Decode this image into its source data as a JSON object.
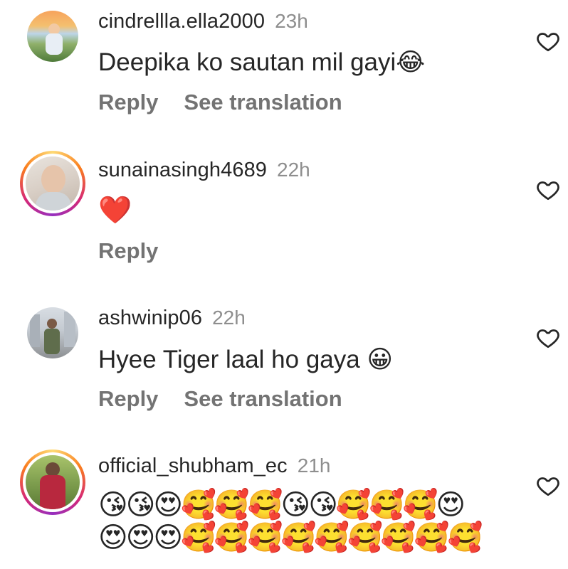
{
  "comments": [
    {
      "username": "cindrellla.ella2000",
      "time": "23h",
      "text": "Deepika ko sautan mil gayi😂",
      "reply_label": "Reply",
      "translate_label": "See translation"
    },
    {
      "username": "sunainasingh4689",
      "time": "22h",
      "text": "❤️",
      "reply_label": "Reply"
    },
    {
      "username": "ashwinip06",
      "time": "22h",
      "text": "Hyee Tiger laal ho gaya 😀",
      "reply_label": "Reply",
      "translate_label": "See translation"
    },
    {
      "username": "official_shubham_ec",
      "time": "21h",
      "emoji_line_1": "😘😘😍🥰🥰🥰😘😘🥰🥰🥰😍",
      "emoji_line_2": "😍😍😍🥰🥰🥰🥰🥰🥰🥰🥰🥰"
    }
  ],
  "icons": {
    "like": "heart-outline-icon",
    "story_ring": "instagram-story-ring"
  },
  "colors": {
    "username": "#262626",
    "meta": "#8e8e8e",
    "action": "#737373",
    "heart_stroke": "#262626"
  }
}
